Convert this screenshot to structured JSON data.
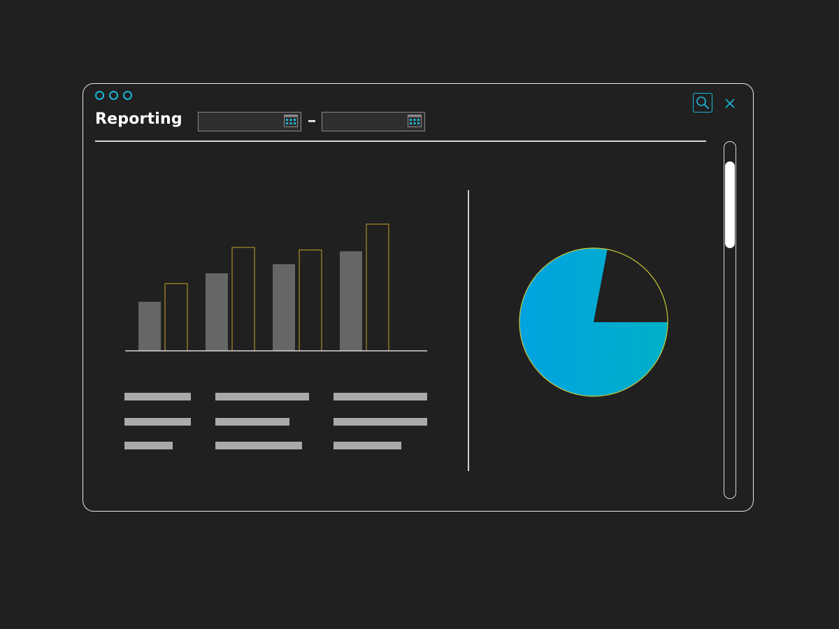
{
  "window": {
    "title": "Reporting",
    "date_range": {
      "start_value": "",
      "separator": "–",
      "end_value": ""
    }
  },
  "icons": {
    "search": "search-icon",
    "close": "close-icon",
    "calendar": "calendar-icon"
  },
  "colors": {
    "background": "#202020",
    "accent": "#1bb6d8",
    "bar_filled": "#666666",
    "bar_outline": "#c9a227",
    "pie_gradient_start": "#00a3e0",
    "pie_gradient_end": "#00b0c8",
    "pie_stroke": "#c8c83a",
    "text_placeholder": "#aaaaaa"
  },
  "chart_data": [
    {
      "type": "bar",
      "categories": [
        "",
        "",
        "",
        ""
      ],
      "series": [
        {
          "values": [
            38,
            60,
            67,
            77
          ]
        },
        {
          "values": [
            52,
            80,
            78,
            98
          ]
        }
      ],
      "title": "",
      "xlabel": "",
      "ylabel": "",
      "ylim": [
        0,
        100
      ],
      "grid": false,
      "legend": false
    },
    {
      "type": "pie",
      "slices": [
        {
          "value": 78,
          "color": "#00a3e0"
        },
        {
          "value": 22,
          "color": "#202020"
        }
      ],
      "title": ""
    }
  ],
  "table_placeholder": {
    "rows": [
      [
        1,
        1,
        1
      ],
      [
        1,
        1,
        1
      ],
      [
        1,
        1,
        1
      ]
    ]
  }
}
